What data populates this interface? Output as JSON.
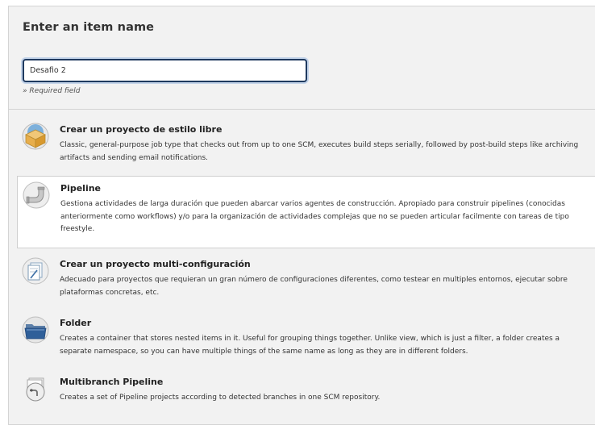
{
  "page": {
    "title": "Enter an item name",
    "name_value": "Desafio 2",
    "required_text": "» Required field"
  },
  "items": [
    {
      "name": "Crear un proyecto de estilo libre",
      "description": "Classic, general-purpose job type that checks out from up to one SCM, executes build steps serially, followed by post-build steps like archiving artifacts and sending email notifications.",
      "icon": "freestyle-box-icon"
    },
    {
      "name": "Pipeline",
      "description": "Gestiona actividades de larga duración que pueden abarcar varios agentes de construcción. Apropiado para construir pipelines (conocidas anteriormente como workflows) y/o para la organización de actividades complejas que no se pueden articular facilmente con tareas de tipo freestyle.",
      "icon": "pipeline-pipe-icon",
      "selected": true
    },
    {
      "name": "Crear un proyecto multi-configuración",
      "description": "Adecuado para proyectos que requieran un gran número de configuraciones diferentes, como testear en multiples entornos, ejecutar sobre plataformas concretas, etc.",
      "icon": "multi-config-icon"
    },
    {
      "name": "Folder",
      "description": "Creates a container that stores nested items in it. Useful for grouping things together. Unlike view, which is just a filter, a folder creates a separate namespace, so you can have multiple things of the same name as long as they are in different folders.",
      "icon": "folder-icon"
    },
    {
      "name": "Multibranch Pipeline",
      "description": "Creates a set of Pipeline projects according to detected branches in one SCM repository.",
      "icon": "multibranch-pipeline-icon"
    }
  ]
}
